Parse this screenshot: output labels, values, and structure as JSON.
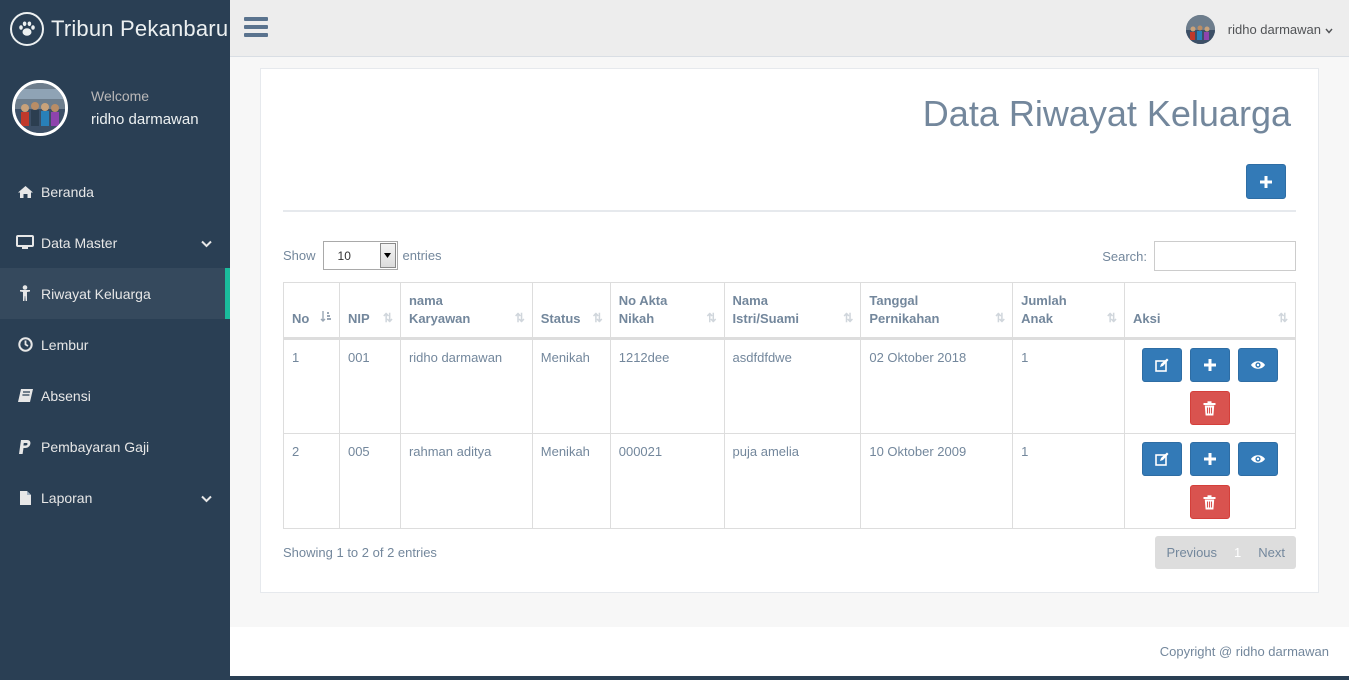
{
  "brand": {
    "title": "Tribun Pekanbaru",
    "logo_icon": "paw-icon"
  },
  "profile": {
    "welcome": "Welcome",
    "name": "ridho darmawan"
  },
  "menu": [
    {
      "label": "Beranda",
      "icon": "home-icon",
      "has_submenu": false,
      "active": false
    },
    {
      "label": "Data Master",
      "icon": "desktop-icon",
      "has_submenu": true,
      "active": false
    },
    {
      "label": "Riwayat Keluarga",
      "icon": "person-icon",
      "has_submenu": false,
      "active": true
    },
    {
      "label": "Lembur",
      "icon": "clock-icon",
      "has_submenu": false,
      "active": false
    },
    {
      "label": "Absensi",
      "icon": "book-icon",
      "has_submenu": false,
      "active": false
    },
    {
      "label": "Pembayaran Gaji",
      "icon": "paypal-icon",
      "has_submenu": false,
      "active": false
    },
    {
      "label": "Laporan",
      "icon": "file-icon",
      "has_submenu": true,
      "active": false
    }
  ],
  "topnav": {
    "user_name": "ridho darmawan"
  },
  "page": {
    "title": "Data Riwayat Keluarga"
  },
  "table_controls": {
    "show_label": "Show",
    "entries_value": "10",
    "entries_label": "entries",
    "search_label": "Search:",
    "search_value": ""
  },
  "table": {
    "headers": [
      "No",
      "NIP",
      "nama Karyawan",
      "Status",
      "No Akta Nikah",
      "Nama Istri/Suami",
      "Tanggal Pernikahan",
      "Jumlah Anak",
      "Aksi"
    ],
    "rows": [
      [
        "1",
        "001",
        "ridho darmawan",
        "Menikah",
        "1212dee",
        "asdfdfdwe",
        "02 Oktober 2018",
        "1"
      ],
      [
        "2",
        "005",
        "rahman aditya",
        "Menikah",
        "000021",
        "puja amelia",
        "10 Oktober 2009",
        "1"
      ]
    ],
    "actions": [
      "edit-icon",
      "plus-icon",
      "eye-icon",
      "trash-icon"
    ]
  },
  "table_info": "Showing 1 to 2 of 2 entries",
  "pagination": {
    "previous": "Previous",
    "current": "1",
    "next": "Next"
  },
  "footer": {
    "copyright": "Copyright @ ridho darmawan"
  },
  "colors": {
    "sidebar": "#2A3F54",
    "active_indicator": "#1ABB9C",
    "primary_button": "#337AB7",
    "danger_button": "#D9534F",
    "text": "#73879C"
  }
}
